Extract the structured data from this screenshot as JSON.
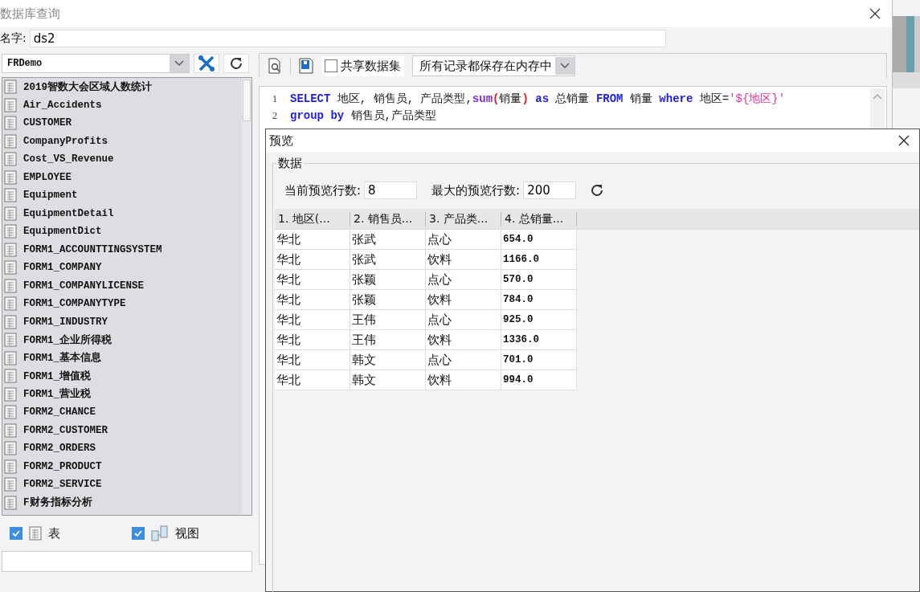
{
  "window": {
    "title": "数据库查询"
  },
  "name_field": {
    "label": "名字:",
    "value": "ds2"
  },
  "connection": {
    "value": "FRDemo"
  },
  "tables": [
    "2019智数大会区域人数统计",
    "Air_Accidents",
    "CUSTOMER",
    "CompanyProfits",
    "Cost_VS_Revenue",
    "EMPLOYEE",
    "Equipment",
    "EquipmentDetail",
    "EquipmentDict",
    "FORM1_ACCOUNTTINGSYSTEM",
    "FORM1_COMPANY",
    "FORM1_COMPANYLICENSE",
    "FORM1_COMPANYTYPE",
    "FORM1_INDUSTRY",
    "FORM1_企业所得税",
    "FORM1_基本信息",
    "FORM1_增值税",
    "FORM1_营业税",
    "FORM2_CHANCE",
    "FORM2_CUSTOMER",
    "FORM2_ORDERS",
    "FORM2_PRODUCT",
    "FORM2_SERVICE",
    "F财务指标分析"
  ],
  "filters": [
    {
      "kind": "table",
      "label": "表",
      "checked": true
    },
    {
      "kind": "view",
      "label": "视图",
      "checked": true
    }
  ],
  "toolbar": {
    "share": {
      "label": "共享数据集",
      "checked": false
    },
    "storage": {
      "value": "所有记录都保存在内存中"
    }
  },
  "sql": {
    "lines": [
      {
        "number": "1",
        "tokens": [
          {
            "kind": "keyword",
            "text": "SELECT"
          },
          {
            "kind": "text",
            "text": " 地区, 销售员, 产品类型,"
          },
          {
            "kind": "function",
            "text": "sum"
          },
          {
            "kind": "paren",
            "text": "("
          },
          {
            "kind": "text",
            "text": "销量"
          },
          {
            "kind": "paren",
            "text": ")"
          },
          {
            "kind": "keyword",
            "text": " as"
          },
          {
            "kind": "text",
            "text": " 总销量 "
          },
          {
            "kind": "keyword",
            "text": "FROM"
          },
          {
            "kind": "text",
            "text": " 销量 "
          },
          {
            "kind": "keyword",
            "text": "where"
          },
          {
            "kind": "text",
            "text": " 地区="
          },
          {
            "kind": "string",
            "text": "'${地区}'"
          }
        ]
      },
      {
        "number": "2",
        "tokens": [
          {
            "kind": "keyword",
            "text": "group by"
          },
          {
            "kind": "text",
            "text": " 销售员,产品类型"
          }
        ]
      }
    ]
  },
  "preview": {
    "title": "预览",
    "group": "数据",
    "current_rows_label": "当前预览行数:",
    "current_rows": "8",
    "max_rows_label": "最大的预览行数:",
    "max_rows": "200",
    "columns": [
      "1. 地区(...",
      "2. 销售员...",
      "3. 产品类...",
      "4. 总销量..."
    ],
    "rows": [
      [
        "华北",
        "张武",
        "点心",
        "654.0"
      ],
      [
        "华北",
        "张武",
        "饮料",
        "1166.0"
      ],
      [
        "华北",
        "张颖",
        "点心",
        "570.0"
      ],
      [
        "华北",
        "张颖",
        "饮料",
        "784.0"
      ],
      [
        "华北",
        "王伟",
        "点心",
        "925.0"
      ],
      [
        "华北",
        "王伟",
        "饮料",
        "1336.0"
      ],
      [
        "华北",
        "韩文",
        "点心",
        "701.0"
      ],
      [
        "华北",
        "韩文",
        "饮料",
        "994.0"
      ]
    ]
  }
}
